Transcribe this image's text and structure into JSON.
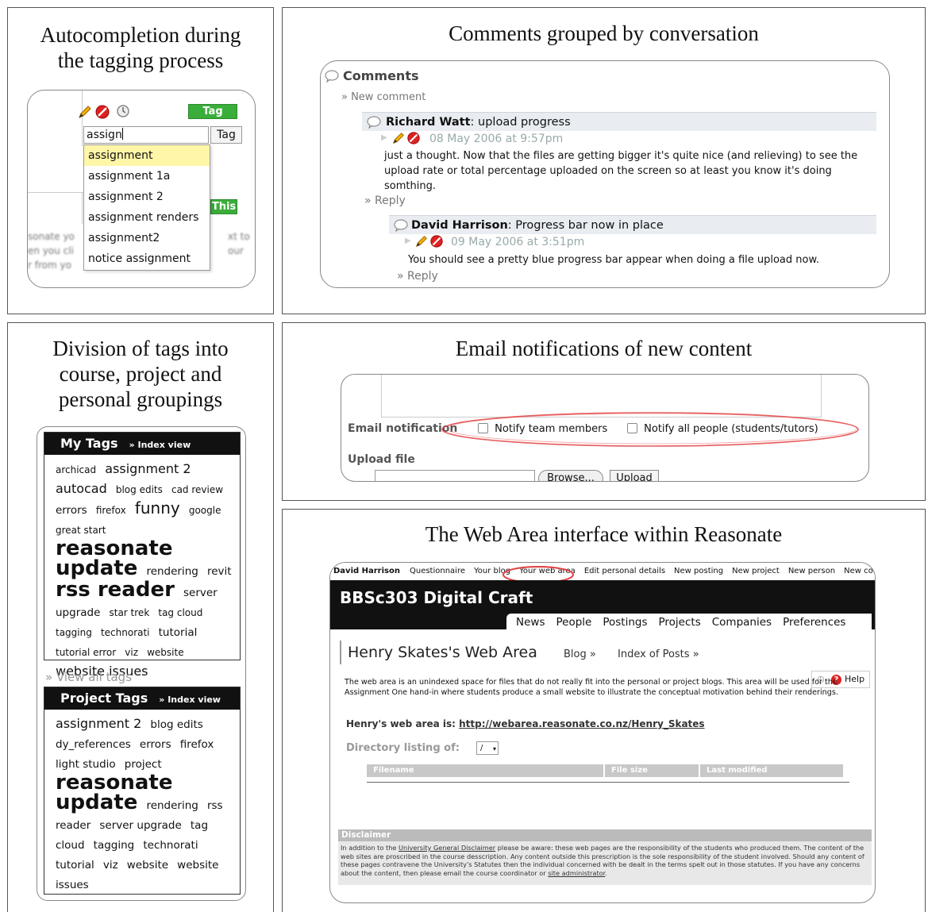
{
  "panel1": {
    "title": "Autocompletion during the tagging process",
    "input_value": "assign",
    "tag_button": "Tag",
    "tag_this_label": "Tag This",
    "tag_this_partial": "This",
    "suggestions": [
      "assignment",
      "assignment 1a",
      "assignment 2",
      "assignment renders",
      "assignment2",
      "notice assignment"
    ],
    "blurred_lines": [
      "sonate yo",
      "xt to",
      "en you cli",
      "our",
      "r from yo"
    ]
  },
  "panel2": {
    "title": "Comments grouped by conversation",
    "heading": "Comments",
    "new_comment": "» New comment",
    "comments": [
      {
        "author": "Richard Watt",
        "subject": ": upload progress",
        "date": "08 May 2006 at 9:57pm",
        "body_lines": [
          "just a thought. Now that the files are getting bigger it's quite nice (and relieving) to see the",
          "upload rate or total percentage uploaded on the screen so at least you know it's doing",
          "somthing."
        ],
        "reply": "» Reply"
      },
      {
        "author": "David Harrison",
        "subject": ": Progress bar now in place",
        "date": "09 May 2006 at 3:51pm",
        "body_lines": [
          "You should see a pretty blue progress bar appear when doing a file upload now."
        ],
        "reply": "» Reply"
      }
    ]
  },
  "panel3": {
    "title": "Division of tags into course, project and personal groupings",
    "my_tags": {
      "heading": "My Tags",
      "index_view": "» Index view",
      "tags": [
        {
          "t": "archicad",
          "s": 1
        },
        {
          "t": "assignment 2",
          "s": 3
        },
        {
          "t": "autocad",
          "s": 3
        },
        {
          "t": "blog edits",
          "s": 1
        },
        {
          "t": "cad review",
          "s": 1
        },
        {
          "t": "errors",
          "s": 2
        },
        {
          "t": "firefox",
          "s": 1
        },
        {
          "t": "funny",
          "s": 4
        },
        {
          "t": "google",
          "s": 1
        },
        {
          "t": "great start",
          "s": 1
        },
        {
          "t": "reasonate",
          "s": 5
        },
        {
          "t": "update",
          "s": 5
        },
        {
          "t": "rendering",
          "s": 2
        },
        {
          "t": "revit",
          "s": 2
        },
        {
          "t": "rss reader",
          "s": 5
        },
        {
          "t": "server",
          "s": 2
        },
        {
          "t": "upgrade",
          "s": 2
        },
        {
          "t": "star trek",
          "s": 1
        },
        {
          "t": "tag cloud",
          "s": 1
        },
        {
          "t": "tagging",
          "s": 1
        },
        {
          "t": "technorati",
          "s": 1
        },
        {
          "t": "tutorial",
          "s": 2
        },
        {
          "t": "tutorial error",
          "s": 1
        },
        {
          "t": "viz",
          "s": 1
        },
        {
          "t": "website",
          "s": 1
        },
        {
          "t": "website issues",
          "s": 3
        }
      ]
    },
    "view_all": "» View all tags",
    "project_tags": {
      "heading": "Project Tags",
      "index_view": "» Index view",
      "tags": [
        {
          "t": "assignment 2",
          "s": 3
        },
        {
          "t": "blog edits",
          "s": 2
        },
        {
          "t": "dy_references",
          "s": 2
        },
        {
          "t": "errors",
          "s": 2
        },
        {
          "t": "firefox",
          "s": 2
        },
        {
          "t": "light studio",
          "s": 2
        },
        {
          "t": "project",
          "s": 2
        },
        {
          "t": "reasonate",
          "s": 5
        },
        {
          "t": "update",
          "s": 5
        },
        {
          "t": "rendering",
          "s": 2
        },
        {
          "t": "rss",
          "s": 2
        },
        {
          "t": "reader",
          "s": 2
        },
        {
          "t": "server upgrade",
          "s": 2
        },
        {
          "t": "tag",
          "s": 2
        },
        {
          "t": "cloud",
          "s": 2
        },
        {
          "t": "tagging",
          "s": 2
        },
        {
          "t": "technorati",
          "s": 2
        },
        {
          "t": "tutorial",
          "s": 2
        },
        {
          "t": "viz",
          "s": 2
        },
        {
          "t": "website",
          "s": 2
        },
        {
          "t": "website",
          "s": 2
        },
        {
          "t": "issues",
          "s": 2
        }
      ]
    }
  },
  "panel4": {
    "title": "Email notifications of new content",
    "email_label": "Email notification",
    "notify_team": "Notify team members",
    "notify_all": "Notify all people (students/tutors)",
    "upload_label": "Upload file",
    "browse": "Browse...",
    "upload": "Upload"
  },
  "panel5": {
    "title": "The Web Area interface within Reasonate",
    "nav": {
      "user": "David Harrison",
      "items": [
        "Questionnaire",
        "Your blog",
        "Your web area",
        "Edit personal details",
        "New posting",
        "New project",
        "New person",
        "New company"
      ]
    },
    "course": "BBSc303 Digital Craft",
    "tabs": [
      "News",
      "People",
      "Postings",
      "Projects",
      "Companies",
      "Preferences"
    ],
    "heading": "Henry Skates's Web Area",
    "blog_link": "Blog »",
    "index_link": "Index of Posts »",
    "help": "Help",
    "description": "The web area is an unindexed space for files that do not really fit into the personal or project blogs. This area will be used for the Assignment One hand-in where students produce a small website to illustrate the conceptual motivation behind their renderings.",
    "webarea_prefix": "Henry's web area is: ",
    "webarea_url": "http://webarea.reasonate.co.nz/Henry_Skates",
    "dir_label": "Directory listing of:",
    "dir_value": "/",
    "table_headers": [
      "Filename",
      "File size",
      "Last modified"
    ],
    "disclaimer_title": "Disclaimer",
    "disclaimer_pre": "In addition to the ",
    "disclaimer_link": "University General Disclaimer",
    "disclaimer_body": " please be aware: these web pages are the responsibility of the students who produced them. The content of the web sites are proscribed in the course desscription. Any content outside this prescription is the sole responsibility of the student involved. Should any content of these pages contravene the University's Statutes then the individual concerned with be dealt in the terms spelt out in those statutes. If you have any concerns about the content, then please email the course coordinator or ",
    "disclaimer_link2": "site administrator",
    "disclaimer_end": "."
  },
  "colors": {
    "accent_green": "#3aad3a",
    "highlight_yellow": "#fff6a8",
    "circle_red": "#e04040",
    "header_black": "#111111"
  }
}
